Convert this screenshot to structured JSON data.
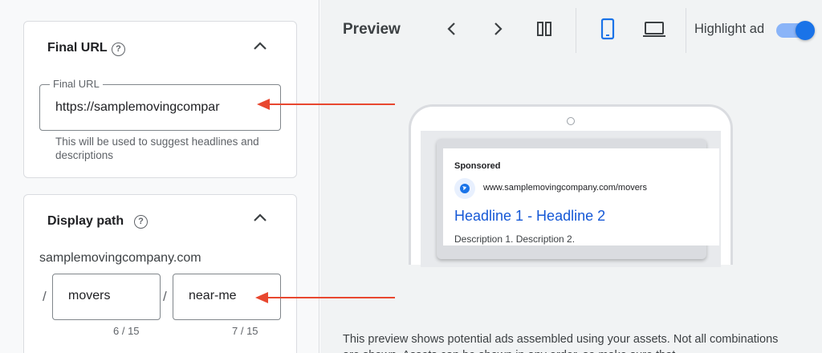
{
  "final_url_section": {
    "title": "Final URL",
    "field_label": "Final URL",
    "field_value": "https://samplemovingcompar",
    "hint": "This will be used to suggest headlines and descriptions"
  },
  "display_path_section": {
    "title": "Display path",
    "domain": "samplemovingcompany.com",
    "separator": "/",
    "path1_value": "movers",
    "path2_value": "near-me",
    "path1_counter": "6 / 15",
    "path2_counter": "7 / 15"
  },
  "preview": {
    "title": "Preview",
    "highlight_label": "Highlight ad",
    "highlight_on": true,
    "ad": {
      "sponsored": "Sponsored",
      "url": "www.samplemovingcompany.com/movers",
      "headline": "Headline 1 - Headline 2",
      "description": "Description 1. Description 2."
    },
    "note": "This preview shows potential ads assembled using your assets. Not all combinations are shown. Assets can be shown in any order, so make sure that"
  },
  "colors": {
    "accent": "#1a73e8",
    "annotation_arrow": "#e8472f",
    "headline_link": "#1558d6"
  },
  "icons": {
    "help": "help-circle-icon",
    "collapse": "chevron-up-icon",
    "prev": "chevron-left-icon",
    "next": "chevron-right-icon",
    "split": "split-view-icon",
    "mobile": "smartphone-icon",
    "desktop": "laptop-icon",
    "globe": "globe-icon"
  }
}
